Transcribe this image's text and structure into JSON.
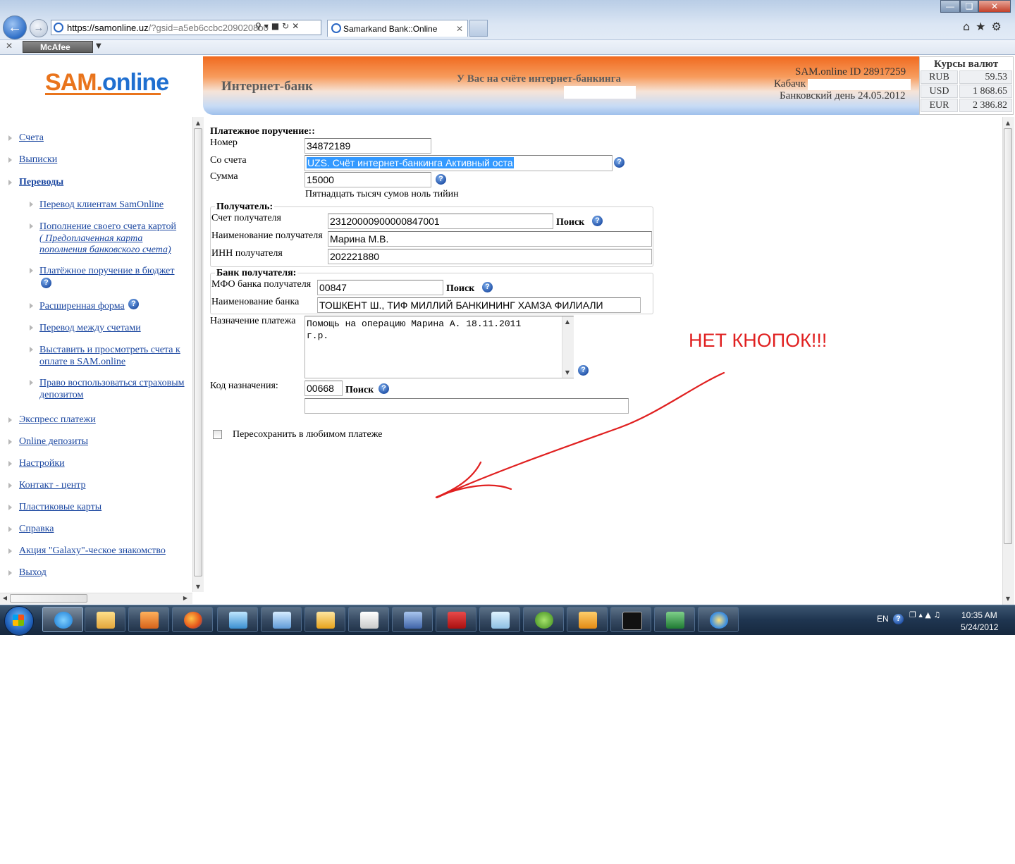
{
  "browser": {
    "url_main": "https://samonline.uz",
    "url_rest": "/?gsid=a5eb6ccbc2090208b0",
    "tab_title": "Samarkand Bank::Online",
    "toolbar_plugin": "McAfee"
  },
  "header": {
    "logo_part1": "SAM.",
    "logo_part2": "online",
    "title": "Интернет-банк",
    "message": "У Вас на счёте интернет-банкинга",
    "account_id": "SAM.online ID 28917259",
    "user_name": "Кабачк",
    "bank_day": "Банковский день 24.05.2012"
  },
  "rates": {
    "title": "Курсы валют",
    "items": [
      {
        "currency": "RUB",
        "value": "59.53"
      },
      {
        "currency": "USD",
        "value": "1 868.65"
      },
      {
        "currency": "EUR",
        "value": "2 386.82"
      }
    ]
  },
  "sidebar": {
    "items": [
      "Счета",
      "Выписки",
      "Переводы"
    ],
    "sub_items": [
      "Перевод клиентам SamOnline",
      "Пополнение своего счета картой",
      "( Предоплаченная карта",
      "пополнения банковского счета)",
      "Платёжное поручение в бюджет",
      "Расширенная форма",
      "Перевод между счетами",
      "Выставить и просмотреть счета к",
      "оплате в SAM.online",
      "Право воспользоваться страховым",
      "депозитом"
    ],
    "items_after": [
      "Экспресс платежи",
      "Online депозиты",
      "Настройки",
      "Контакт - центр",
      "Пластиковые карты",
      "Справка",
      "Акция \"Galaxy\"-ческое знакомство",
      "Выход"
    ]
  },
  "form": {
    "title": "Платежное поручение::",
    "number_label": "Номер",
    "number_value": "34872189",
    "from_label": "Со счета",
    "from_value": "UZS. Счёт интернет-банкинга    Активный оста",
    "amount_label": "Сумма",
    "amount_value": "15000",
    "amount_words": "Пятнадцать тысяч сумов ноль тийин",
    "recipient_legend": "Получатель:",
    "recipient_account_label": "Счет получателя",
    "recipient_account_value": "23120000900000847001",
    "search_label": "Поиск",
    "recipient_name_label": "Наименование получателя",
    "recipient_name_value": "Марина М.В.",
    "inn_label": "ИНН получателя",
    "inn_value": "202221880",
    "bank_legend": "Банк получателя:",
    "mfo_label": "МФО банка получателя",
    "mfo_value": "00847",
    "bank_name_label": "Наименование банка",
    "bank_name_value": "ТОШКЕНТ Ш., ТИФ МИЛЛИЙ БАНКИНИНГ ХАМЗА ФИЛИАЛИ",
    "purpose_label": "Назначение платежа",
    "purpose_line1": "Помощь на операцию Марина А. 18.11.2011",
    "purpose_line2": "г.р.",
    "code_label": "Код назначения:",
    "code_value": "00668",
    "resave_label": "Пересохранить в любимом платеже"
  },
  "annotation": "НЕТ КНОПОК!!!",
  "tray": {
    "lang": "EN",
    "time": "10:35 AM",
    "date": "5/24/2012"
  },
  "colors": {
    "link": "#1a46a0",
    "annotation": "#e02020",
    "banner_orange": "#f06a1f",
    "selection": "#3399ff"
  }
}
